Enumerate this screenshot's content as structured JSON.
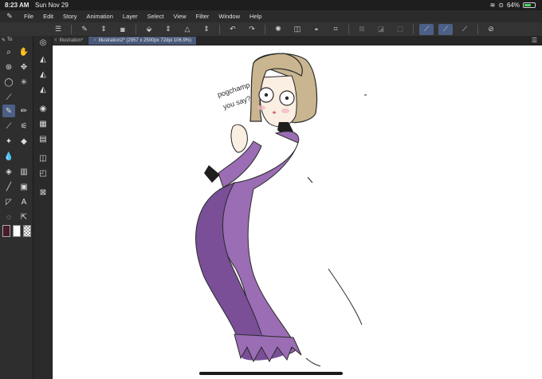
{
  "status_bar": {
    "time": "8:23 AM",
    "date": "Sun Nov 29",
    "battery": "64%",
    "battery_level": 0.64
  },
  "menu": {
    "items": [
      "File",
      "Edit",
      "Story",
      "Animation",
      "Layer",
      "Select",
      "View",
      "Filter",
      "Window",
      "Help"
    ]
  },
  "tabs": [
    {
      "label": "Illustration*",
      "active": false
    },
    {
      "label": "Illustration2* (2957 x 2500px 72dpi 106.9%)",
      "active": true
    }
  ],
  "tool_panel": {
    "tab_label": "To"
  },
  "canvas": {
    "speech_text_line1": "pogchamp",
    "speech_text_line2": "you say?"
  },
  "colors": {
    "app_bg": "#1e1e1e",
    "toolbar_bg": "#333333",
    "accent": "#4c5f86",
    "dress": "#9b6db4",
    "dress_shadow": "#7a4f97",
    "hair": "#c9b58f",
    "skin": "#fbeee2",
    "main_color": "#4a1a2a"
  }
}
